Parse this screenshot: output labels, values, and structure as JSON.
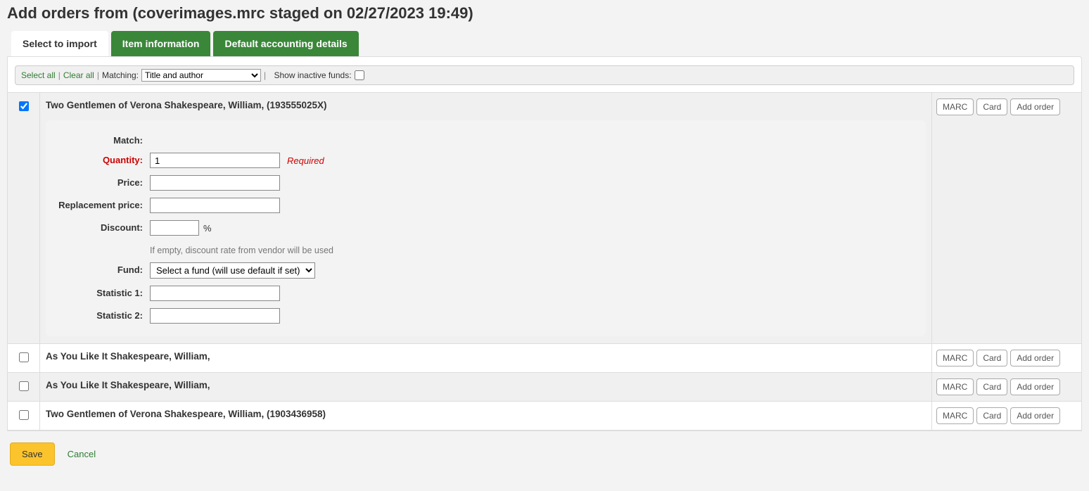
{
  "page_title": "Add orders from (coverimages.mrc staged on 02/27/2023 19:49)",
  "tabs": {
    "select": "Select to import",
    "item_info": "Item information",
    "accounting": "Default accounting details"
  },
  "toolbar": {
    "select_all": "Select all",
    "clear_all": "Clear all",
    "matching_label": "Matching:",
    "matching_value": "Title and author",
    "show_inactive": "Show inactive funds:"
  },
  "action_buttons": {
    "marc": "MARC",
    "card": "Card",
    "add_order": "Add order"
  },
  "records": [
    {
      "title": "Two Gentlemen of Verona Shakespeare, William, (193555025X)",
      "checked": true,
      "expanded": true
    },
    {
      "title": "As You Like It Shakespeare, William,",
      "checked": false,
      "expanded": false
    },
    {
      "title": "As You Like It Shakespeare, William,",
      "checked": false,
      "expanded": false
    },
    {
      "title": "Two Gentlemen of Verona Shakespeare, William, (1903436958)",
      "checked": false,
      "expanded": false
    }
  ],
  "detail_form": {
    "match_label": "Match:",
    "quantity_label": "Quantity:",
    "quantity_value": "1",
    "required_text": "Required",
    "price_label": "Price:",
    "price_value": "",
    "replacement_label": "Replacement price:",
    "replacement_value": "",
    "discount_label": "Discount:",
    "discount_value": "",
    "discount_unit": "%",
    "discount_hint": "If empty, discount rate from vendor will be used",
    "fund_label": "Fund:",
    "fund_value": "Select a fund (will use default if set)",
    "stat1_label": "Statistic 1:",
    "stat1_value": "",
    "stat2_label": "Statistic 2:",
    "stat2_value": ""
  },
  "footer": {
    "save": "Save",
    "cancel": "Cancel"
  }
}
